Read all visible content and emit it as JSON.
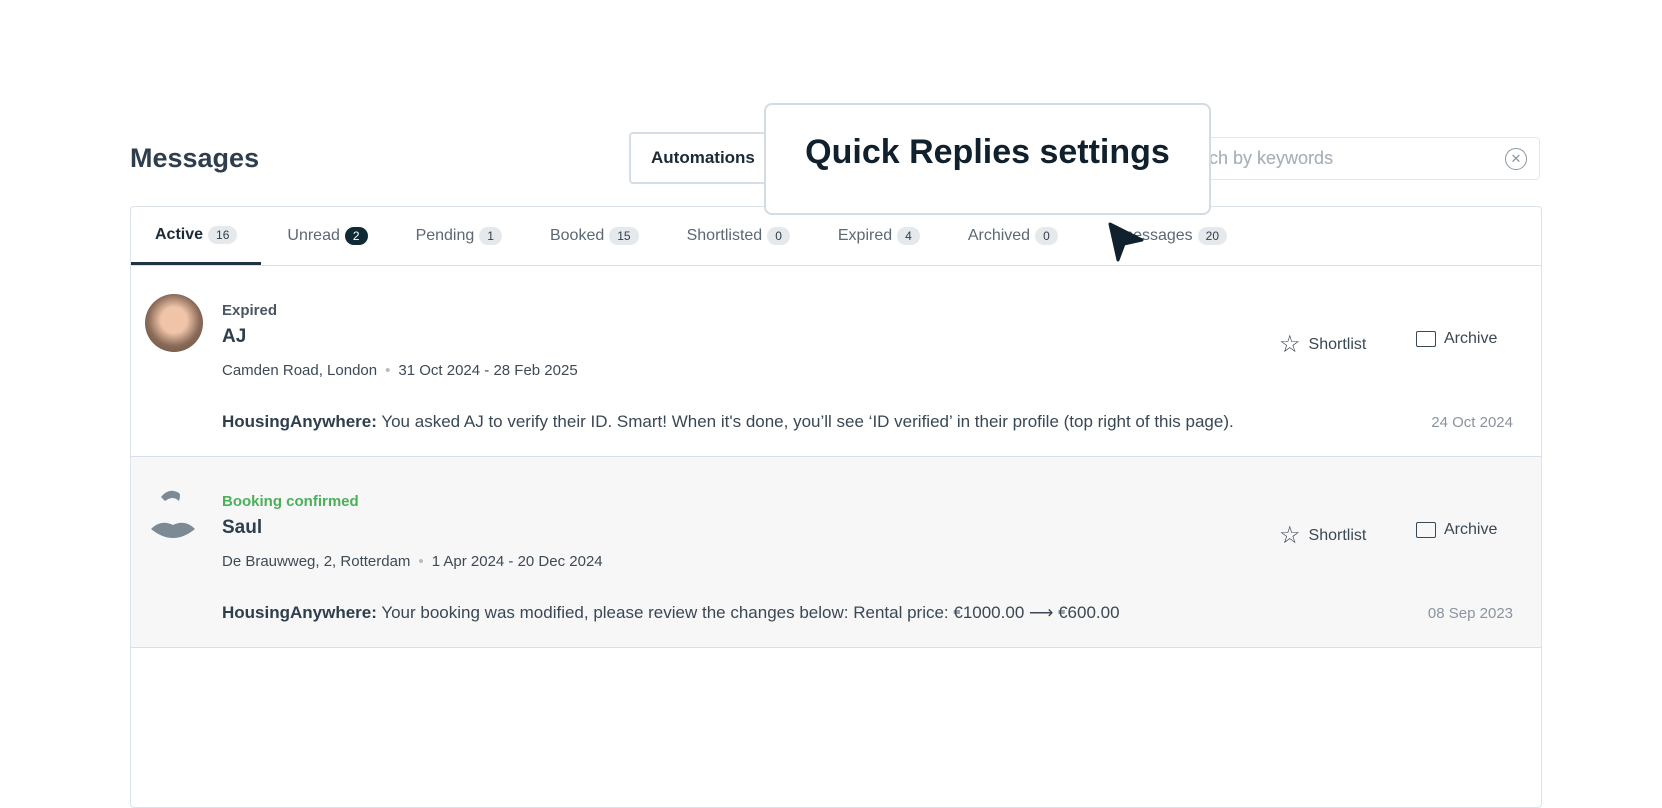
{
  "header": {
    "title": "Messages",
    "automations_label": "Automations",
    "search_placeholder": "Search by keywords",
    "search_visible": "ch by keywords"
  },
  "tooltip": {
    "text": "Quick Replies settings"
  },
  "tabs": [
    {
      "label": "Active",
      "count": "16"
    },
    {
      "label": "Unread",
      "count": "2"
    },
    {
      "label": "Pending",
      "count": "1"
    },
    {
      "label": "Booked",
      "count": "15"
    },
    {
      "label": "Shortlisted",
      "count": "0"
    },
    {
      "label": "Expired",
      "count": "4"
    },
    {
      "label": "Archived",
      "count": "0"
    },
    {
      "label": "messages",
      "count": "20"
    }
  ],
  "conversations": [
    {
      "status": "Expired",
      "name": "AJ",
      "address": "Camden Road, London",
      "dates": "31 Oct 2024 - 28 Feb 2025",
      "sender": "HousingAnywhere:",
      "message": "You asked AJ to verify their ID. Smart! When it's done, you’ll see ‘ID verified’ in their profile (top right of this page).",
      "date": "24 Oct 2024",
      "shortlist": "Shortlist",
      "archive": "Archive"
    },
    {
      "status": "Booking confirmed",
      "name": "Saul",
      "address": "De Brauwweg, 2, Rotterdam",
      "dates": "1 Apr 2024 - 20 Dec 2024",
      "sender": "HousingAnywhere:",
      "message": "Your booking was modified, please review the changes below: Rental price: €1000.00 ⟶ €600.00",
      "date": "08 Sep 2023",
      "shortlist": "Shortlist",
      "archive": "Archive"
    }
  ],
  "colors": {
    "status_confirmed": "#4cb05a",
    "accent_dark": "#0f2a36"
  }
}
